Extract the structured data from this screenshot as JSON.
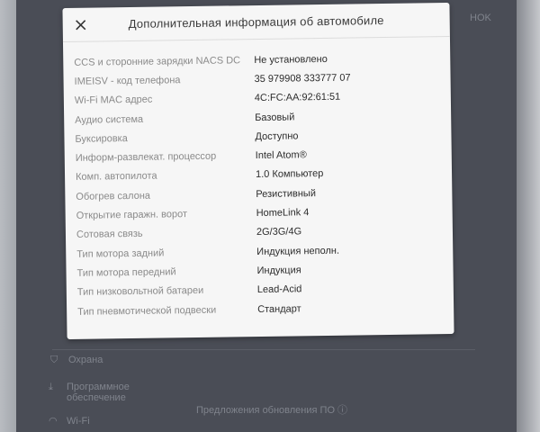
{
  "dialog": {
    "title": "Дополнительная информация об автомобиле",
    "close_icon": "close-icon",
    "rows": [
      {
        "label": "CCS и сторонние зарядки NACS DC",
        "value": "Не установлено"
      },
      {
        "label": "IMEISV - код телефона",
        "value": "35 979908 333777 07"
      },
      {
        "label": "Wi-Fi MAC адрес",
        "value": "4C:FC:AA:92:61:51"
      },
      {
        "label": "Аудио система",
        "value": "Базовый"
      },
      {
        "label": "Буксировка",
        "value": "Доступно"
      },
      {
        "label": "Информ-развлекат. процессор",
        "value": "Intel Atom®"
      },
      {
        "label": "Комп. автопилота",
        "value": "1.0 Компьютер"
      },
      {
        "label": "Обогрев салона",
        "value": "Резистивный"
      },
      {
        "label": "Открытие гаражн. ворот",
        "value": "HomeLink 4"
      },
      {
        "label": "Сотовая связь",
        "value": "2G/3G/4G"
      },
      {
        "label": "Тип мотора задний",
        "value": "Индукция неполн."
      },
      {
        "label": "Тип мотора передний",
        "value": "Индукция"
      },
      {
        "label": "Тип низковольтной батареи",
        "value": "Lead-Acid"
      },
      {
        "label": "Тип пневмотической подвески",
        "value": "Стандарт"
      }
    ]
  },
  "background": {
    "corner_label": "HOK",
    "sidebar": [
      {
        "icon": "shield-icon",
        "label": "Охрана"
      },
      {
        "icon": "download-icon",
        "label": "Программное обеспечение"
      },
      {
        "icon": "wifi-icon",
        "label": "Wi-Fi"
      }
    ],
    "notice": "Предложения обновления ПО ⓘ"
  },
  "colors": {
    "dialog_bg": "#f6f6f6",
    "screen_bg": "#4a4d56",
    "label_text": "#8a8a8a",
    "value_text": "#2c2c2c"
  }
}
